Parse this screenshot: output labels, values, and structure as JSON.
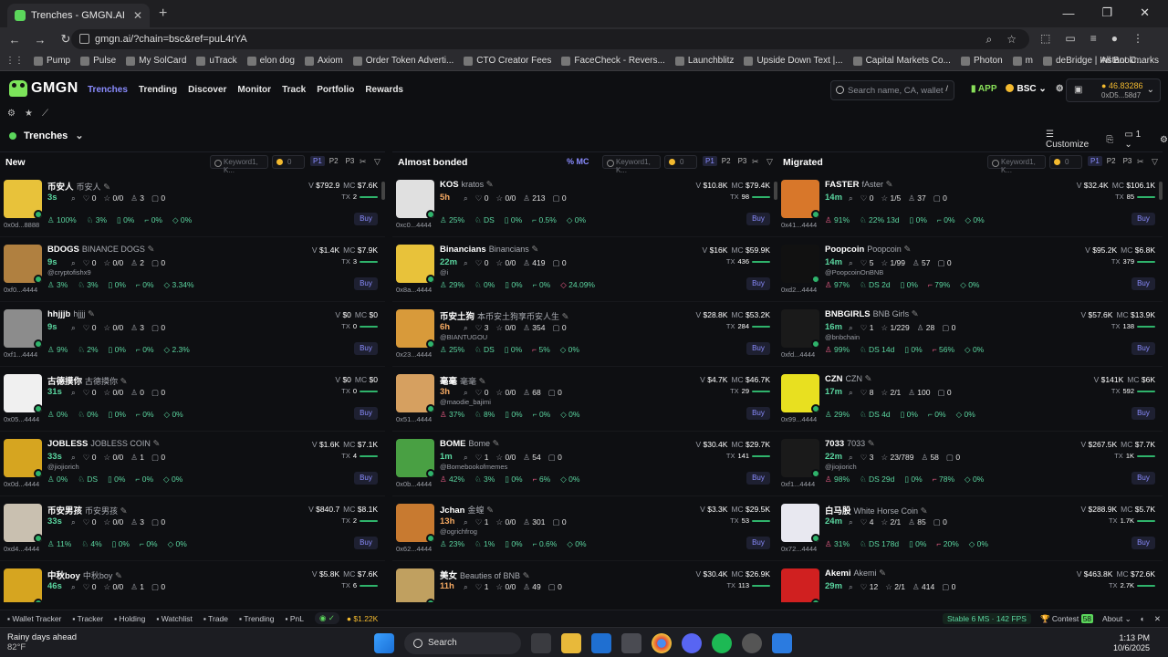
{
  "browser": {
    "tab_title": "Trenches - GMGN.AI Fast Trade",
    "url": "gmgn.ai/?chain=bsc&ref=puL4rYA",
    "bookmarks": [
      "Pump",
      "Pulse",
      "My SolCard",
      "uTrack",
      "elon dog",
      "Axiom",
      "Order Token Adverti...",
      "CTO Creator Fees",
      "FaceCheck - Revers...",
      "Launchblitz",
      "Upside Down Text |...",
      "Capital Markets Co...",
      "Photon",
      "m",
      "deBridge | Instant C..."
    ],
    "all_bookmarks": "All Bookmarks"
  },
  "header": {
    "logo": "GMGN",
    "nav": [
      "Trenches",
      "Trending",
      "Discover",
      "Monitor",
      "Track",
      "Portfolio",
      "Rewards"
    ],
    "search_placeholder": "Search name, CA, wallet",
    "slash": "/",
    "app": "APP",
    "chain": "BSC",
    "balance": "46.83286",
    "wallet": "0xD5...58d7"
  },
  "trenches": {
    "title": "Trenches",
    "customize": "Customize",
    "page": "1"
  },
  "columns": [
    {
      "title": "New",
      "kw": "Keyword1, K...",
      "amt": "0",
      "pages": [
        "P1",
        "P2",
        "P3"
      ],
      "tokens": [
        {
          "name": "币安人",
          "sub": "币安人",
          "age": "3s",
          "s": [
            "0",
            "0/0",
            "3",
            "0"
          ],
          "h": "",
          "addr": "0x0d...8888",
          "p": [
            "100%",
            "3%",
            "0%",
            "0%",
            "0%"
          ],
          "v": "$792.9",
          "mc": "$7.6K",
          "tx": "2",
          "bg": "#e8c23a"
        },
        {
          "name": "BDOGS",
          "sub": "BINANCE DOGS",
          "age": "9s",
          "s": [
            "0",
            "0/0",
            "2",
            "0"
          ],
          "h": "@cryptofishx9",
          "addr": "0xf0...4444",
          "p": [
            "3%",
            "3%",
            "0%",
            "0%",
            "3.34%"
          ],
          "v": "$1.4K",
          "mc": "$7.9K",
          "tx": "3",
          "bg": "#b08040"
        },
        {
          "name": "hhjjjb",
          "sub": "hjjjj",
          "age": "9s",
          "s": [
            "0",
            "0/0",
            "3",
            "0"
          ],
          "h": "",
          "addr": "0xf1...4444",
          "p": [
            "9%",
            "2%",
            "0%",
            "0%",
            "2.3%"
          ],
          "v": "$0",
          "mc": "$0",
          "tx": "0",
          "bg": "#8c8c8c"
        },
        {
          "name": "古德摸你",
          "sub": "古德摸你",
          "age": "31s",
          "s": [
            "0",
            "0/0",
            "0",
            "0"
          ],
          "h": "",
          "addr": "0x05...4444",
          "p": [
            "0%",
            "0%",
            "0%",
            "0%",
            "0%"
          ],
          "v": "$0",
          "mc": "$0",
          "tx": "0",
          "bg": "#f0f0f0"
        },
        {
          "name": "JOBLESS",
          "sub": "JOBLESS COIN",
          "age": "33s",
          "s": [
            "0",
            "0/0",
            "1",
            "0"
          ],
          "h": "@jiojiorich",
          "addr": "0x0d...4444",
          "p": [
            "0%",
            "DS",
            "0%",
            "0%",
            "0%"
          ],
          "v": "$1.6K",
          "mc": "$7.1K",
          "tx": "4",
          "bg": "#d6a520"
        },
        {
          "name": "币安男孩",
          "sub": "币安男孩",
          "age": "33s",
          "s": [
            "0",
            "0/0",
            "3",
            "0"
          ],
          "h": "",
          "addr": "0xd4...4444",
          "p": [
            "11%",
            "4%",
            "0%",
            "0%",
            "0%"
          ],
          "v": "$840.7",
          "mc": "$8.1K",
          "tx": "2",
          "bg": "#c9c0b0"
        },
        {
          "name": "中秋boy",
          "sub": "中秋boy",
          "age": "46s",
          "s": [
            "0",
            "0/0",
            "1",
            "0"
          ],
          "h": "",
          "addr": "",
          "p": [],
          "v": "$5.8K",
          "mc": "$7.6K",
          "tx": "6",
          "bg": "#d6a520"
        }
      ]
    },
    {
      "title": "Almost bonded",
      "kw": "Keyword1, K...",
      "amt": "0",
      "pages": [
        "P1",
        "P2",
        "P3"
      ],
      "mode": "MC",
      "tokens": [
        {
          "name": "KOS",
          "sub": "kratos",
          "age": "5h",
          "s": [
            "0",
            "0/0",
            "213",
            "0"
          ],
          "h": "",
          "addr": "0xc0...4444",
          "p": [
            "25%",
            "DS",
            "0%",
            "0.5%",
            "0%"
          ],
          "v": "$10.8K",
          "mc": "$79.4K",
          "tx": "98",
          "bg": "#e0e0e0"
        },
        {
          "name": "Binancians",
          "sub": "Binancians",
          "age": "22m",
          "s": [
            "0",
            "0/0",
            "419",
            "0"
          ],
          "h": "@i",
          "addr": "0x8a...4444",
          "p": [
            "29%",
            "0%",
            "0%",
            "0%",
            "24.09%"
          ],
          "v": "$16K",
          "mc": "$59.9K",
          "tx": "436",
          "bg": "#e8c23a"
        },
        {
          "name": "币安土狗",
          "sub": "本币安土狗享币安人生",
          "age": "6h",
          "s": [
            "3",
            "0/0",
            "354",
            "0"
          ],
          "h": "@BIANTUGOU",
          "addr": "0x23...4444",
          "p": [
            "25%",
            "DS",
            "0%",
            "5%",
            "0%"
          ],
          "v": "$28.8K",
          "mc": "$53.2K",
          "tx": "284",
          "bg": "#d89a3a"
        },
        {
          "name": "毫毫",
          "sub": "毫毫",
          "age": "3h",
          "s": [
            "0",
            "0/0",
            "68",
            "0"
          ],
          "h": "@maodie_bajimi",
          "addr": "0x51...4444",
          "p": [
            "37%",
            "8%",
            "0%",
            "0%",
            "0%"
          ],
          "v": "$4.7K",
          "mc": "$46.7K",
          "tx": "29",
          "bg": "#d6a060"
        },
        {
          "name": "BOME",
          "sub": "Bome",
          "age": "1m",
          "s": [
            "1",
            "0/0",
            "54",
            "0"
          ],
          "h": "@Bomebookofmemes",
          "addr": "0x0b...4444",
          "p": [
            "42%",
            "3%",
            "0%",
            "6%",
            "0%"
          ],
          "v": "$30.4K",
          "mc": "$29.7K",
          "tx": "141",
          "bg": "#49a043"
        },
        {
          "name": "Jchan",
          "sub": "金蝗",
          "age": "13h",
          "s": [
            "1",
            "0/0",
            "301",
            "0"
          ],
          "h": "@ogrichfrog",
          "addr": "0x62...4444",
          "p": [
            "23%",
            "1%",
            "0%",
            "0.6%",
            "0%"
          ],
          "v": "$3.3K",
          "mc": "$29.5K",
          "tx": "53",
          "bg": "#c87a30"
        },
        {
          "name": "美女",
          "sub": "Beauties of BNB",
          "age": "11h",
          "s": [
            "1",
            "0/0",
            "49",
            "0"
          ],
          "h": "",
          "addr": "",
          "p": [],
          "v": "$30.4K",
          "mc": "$26.9K",
          "tx": "113",
          "bg": "#c0a060"
        }
      ]
    },
    {
      "title": "Migrated",
      "kw": "Keyword1, K...",
      "amt": "0",
      "pages": [
        "P1",
        "P2",
        "P3"
      ],
      "tokens": [
        {
          "name": "FASTER",
          "sub": "fAster",
          "age": "14m",
          "s": [
            "0",
            "1/5",
            "37",
            "0"
          ],
          "h": "",
          "addr": "0x41...4444",
          "p": [
            "91%",
            "22% 13d",
            "0%",
            "0%",
            "0%"
          ],
          "v": "$32.4K",
          "mc": "$106.1K",
          "tx": "85",
          "bg": "#d8772a"
        },
        {
          "name": "Poopcoin",
          "sub": "Poopcoin",
          "age": "14m",
          "s": [
            "5",
            "1/99",
            "57",
            "0"
          ],
          "h": "@PoopcoinOnBNB",
          "addr": "0xd2...4444",
          "p": [
            "97%",
            "DS 2d",
            "0%",
            "79%",
            "0%"
          ],
          "v": "$95.2K",
          "mc": "$6.8K",
          "tx": "379",
          "bg": "#111111"
        },
        {
          "name": "BNBGIRLS",
          "sub": "BNB Girls",
          "age": "16m",
          "s": [
            "1",
            "1/229",
            "28",
            "0"
          ],
          "h": "@bnbchain",
          "addr": "0xfd...4444",
          "p": [
            "99%",
            "DS 14d",
            "0%",
            "56%",
            "0%"
          ],
          "v": "$57.6K",
          "mc": "$13.9K",
          "tx": "138",
          "bg": "#1a1a1a"
        },
        {
          "name": "CZN",
          "sub": "CZN",
          "age": "17m",
          "s": [
            "8",
            "2/1",
            "100",
            "0"
          ],
          "h": "",
          "addr": "0x99...4444",
          "p": [
            "29%",
            "DS 4d",
            "0%",
            "0%",
            "0%"
          ],
          "v": "$141K",
          "mc": "$6K",
          "tx": "592",
          "bg": "#e8e020"
        },
        {
          "name": "7033",
          "sub": "7033",
          "age": "22m",
          "s": [
            "3",
            "23/789",
            "58",
            "0"
          ],
          "h": "@jiojiorich",
          "addr": "0xf1...4444",
          "p": [
            "98%",
            "DS 29d",
            "0%",
            "78%",
            "0%"
          ],
          "v": "$267.5K",
          "mc": "$7.7K",
          "tx": "1K",
          "bg": "#1a1a1a"
        },
        {
          "name": "白马股",
          "sub": "White Horse Coin",
          "age": "24m",
          "s": [
            "4",
            "2/1",
            "85",
            "0"
          ],
          "h": "",
          "addr": "0x72...4444",
          "p": [
            "31%",
            "DS 178d",
            "0%",
            "20%",
            "0%"
          ],
          "v": "$288.9K",
          "mc": "$5.7K",
          "tx": "1.7K",
          "bg": "#e8e8f0"
        },
        {
          "name": "Akemi",
          "sub": "Akemi",
          "age": "29m",
          "s": [
            "12",
            "2/1",
            "414",
            "0"
          ],
          "h": "",
          "addr": "",
          "p": [],
          "v": "$463.8K",
          "mc": "$72.6K",
          "tx": "2.7K",
          "bg": "#d02020"
        }
      ]
    }
  ],
  "footer": {
    "items": [
      "Wallet Tracker",
      "Tracker",
      "Holding",
      "Watchlist",
      "Trade",
      "Trending",
      "PnL"
    ],
    "sol": "$1.22K",
    "stable": "Stable 6 MS · 142 FPS",
    "contest": "Contest",
    "contest_badge": "58",
    "about": "About"
  },
  "labels": {
    "buy": "Buy",
    "tx": "TX",
    "v": "V",
    "mc": "MC"
  },
  "taskbar": {
    "weather": "Rainy days ahead",
    "temp": "82°F",
    "search": "Search",
    "time": "1:13 PM",
    "date": "10/6/2025"
  }
}
